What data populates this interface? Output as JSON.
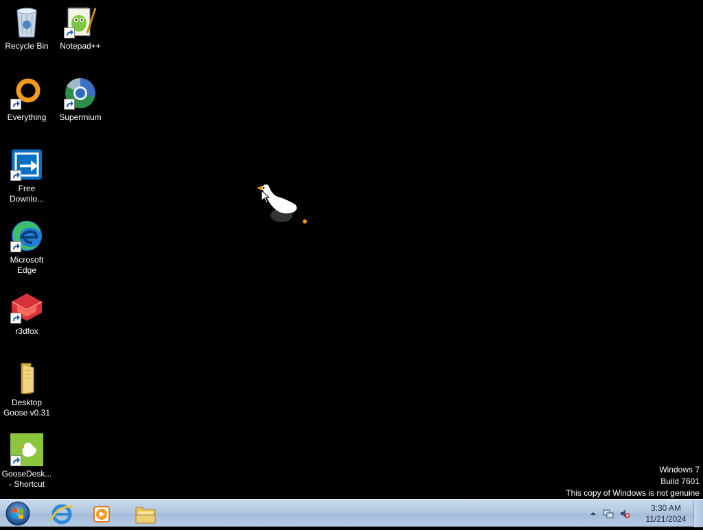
{
  "desktop": {
    "icons": [
      {
        "label": "Recycle Bin"
      },
      {
        "label": "Notepad++"
      },
      {
        "label": "Everything"
      },
      {
        "label": "Supermium"
      },
      {
        "label": "Free\nDownlo..."
      },
      {
        "label": "Microsoft\nEdge"
      },
      {
        "label": "r3dfox"
      },
      {
        "label": "Desktop\nGoose v0.31"
      },
      {
        "label": "GooseDesk...\n- Shortcut"
      }
    ]
  },
  "watermark": {
    "line1": "Windows 7",
    "line2": "Build 7601",
    "line3": "This copy of Windows is not genuine"
  },
  "taskbar": {
    "pinned": [
      {
        "icon": "internet-explorer-icon"
      },
      {
        "icon": "media-player-icon"
      },
      {
        "icon": "windows-explorer-icon"
      }
    ],
    "tray": {
      "time": "3:30 AM",
      "date": "11/21/2024"
    }
  },
  "colors": {
    "desktop_bg": "#000000",
    "taskbar_bg": "#b3c8e2",
    "label_text": "#ffffff"
  }
}
